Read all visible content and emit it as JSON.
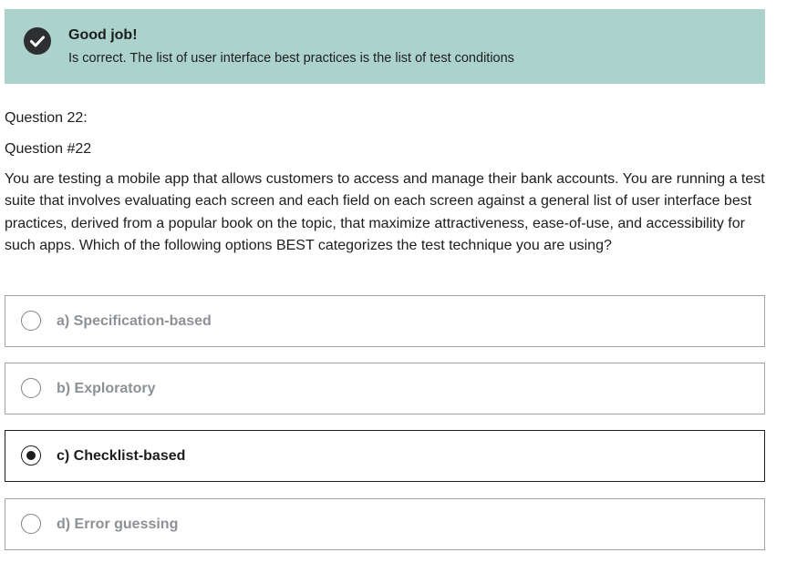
{
  "feedback": {
    "icon": "check-circle-icon",
    "title": "Good job!",
    "message": "Is correct. The list of user interface best practices is the list of test conditions",
    "background_color": "#acd2cc"
  },
  "question": {
    "number_label": "Question 22:",
    "title": "Question #22",
    "body": "You are testing a mobile app that allows customers to access and manage their bank accounts. You are running a test suite that involves evaluating each screen and each field on each screen against a general list of user interface best practices, derived from a popular book on the topic, that maximize attractiveness, ease-of-use, and accessibility for such apps. Which of the following options BEST categorizes the test technique you are using?"
  },
  "options": [
    {
      "label": "a) Specification-based",
      "selected": false
    },
    {
      "label": "b) Exploratory",
      "selected": false
    },
    {
      "label": "c) Checklist-based",
      "selected": true
    },
    {
      "label": "d) Error guessing",
      "selected": false
    }
  ]
}
